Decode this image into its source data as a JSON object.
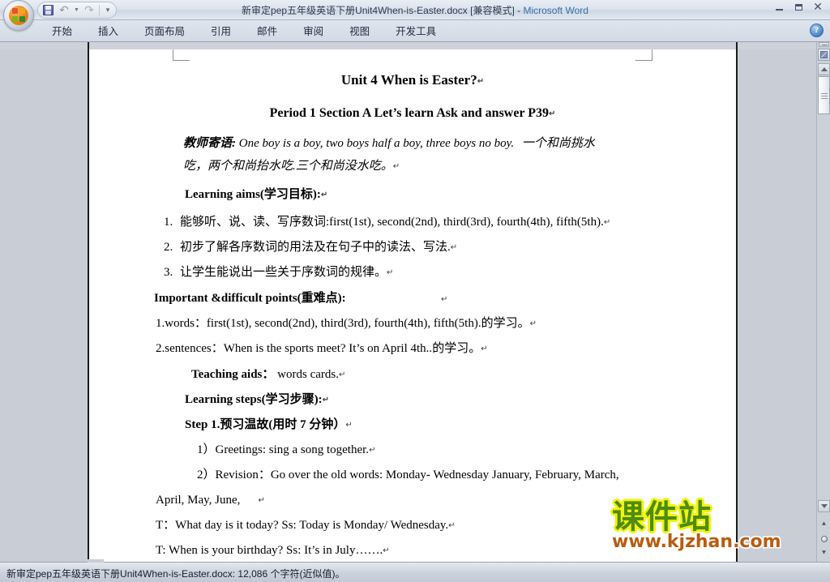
{
  "window": {
    "title_document": "新审定pep五年级英语下册Unit4When-is-Easter.docx [兼容模式]",
    "title_separator": " - ",
    "title_app": "Microsoft Word",
    "minimize_label": "",
    "restore_label": "",
    "close_label": "✕"
  },
  "quick_access": {
    "save_label": "",
    "undo_label": "↰",
    "undo_dropdown": "▾",
    "redo_label": "↻",
    "customize_label": "▾"
  },
  "ribbon": {
    "tabs": [
      {
        "label": "开始"
      },
      {
        "label": "插入"
      },
      {
        "label": "页面布局"
      },
      {
        "label": "引用"
      },
      {
        "label": "邮件"
      },
      {
        "label": "审阅"
      },
      {
        "label": "视图"
      },
      {
        "label": "开发工具"
      }
    ],
    "help_label": "?"
  },
  "document": {
    "lines": [
      {
        "id": "title",
        "text": "Unit 4    When is Easter?",
        "mark": "↵"
      },
      {
        "id": "subtitle",
        "text": "Period 1 Section A    Let’s learn    Ask and answer    P39",
        "mark": "↵"
      },
      {
        "id": "quote_cn",
        "text": "教师寄语:",
        "mark": ""
      },
      {
        "id": "quote_en",
        "text": "One boy is a boy, two boys half a boy, three boys no boy.",
        "mark": ""
      },
      {
        "id": "quote_cn2",
        "text": "一个和尚挑水",
        "mark": ""
      },
      {
        "id": "quote_cn3",
        "text": "吃，两个和尚抬水吃.三个和尚没水吃。",
        "mark": "↵"
      },
      {
        "id": "aims_head",
        "text": "Learning aims(学习目标):",
        "mark": "↵"
      },
      {
        "id": "aim1_num",
        "text": "1.",
        "mark": ""
      },
      {
        "id": "aim1_cn",
        "text": "能够听、说、读、写序数词:",
        "mark": ""
      },
      {
        "id": "aim1_en",
        "text": "first(1st), second(2nd), third(3rd),   fourth(4th), fifth(5th).",
        "mark": "↵"
      },
      {
        "id": "aim2_num",
        "text": "2.",
        "mark": ""
      },
      {
        "id": "aim2",
        "text": "初步了解各序数词的用法及在句子中的读法、写法.",
        "mark": "↵"
      },
      {
        "id": "aim3_num",
        "text": "3.",
        "mark": ""
      },
      {
        "id": "aim3",
        "text": "让学生能说出一些关于序数词的规律。",
        "mark": "↵"
      },
      {
        "id": "points_head",
        "text": "Important &difficult points(重难点):",
        "mark": "↵"
      },
      {
        "id": "words_line_a",
        "text": "1.words：first(1st), second(2nd), third(3rd),   fourth(4th), fifth(5th).",
        "mark": ""
      },
      {
        "id": "words_line_b",
        "text": "的学习。",
        "mark": "↵"
      },
      {
        "id": "sent_line_a",
        "text": "2.sentences：When is the sports meet?   It’s on April 4th..",
        "mark": ""
      },
      {
        "id": "sent_line_b",
        "text": "的学习。",
        "mark": "↵"
      },
      {
        "id": "aids_head",
        "text": "Teaching   aids：",
        "mark": ""
      },
      {
        "id": "aids_body",
        "text": "words cards.",
        "mark": "↵"
      },
      {
        "id": "steps_head",
        "text": "Learning steps(学习步骤):",
        "mark": "↵"
      },
      {
        "id": "step1",
        "text": "Step 1.预习温故(用时 7 分钟）",
        "mark": "↵"
      },
      {
        "id": "g1",
        "text": "1）Greetings: sing a song together.",
        "mark": "↵"
      },
      {
        "id": "g2",
        "text": "2）Revision：Go over the old words: Monday- Wednesday January, February, March,",
        "mark": ""
      },
      {
        "id": "g2b",
        "text": "April,    May,  June,",
        "mark": "↵"
      },
      {
        "id": "t1",
        "text": "T：What day is it today?        Ss: Today is Monday/ Wednesday.",
        "mark": "↵"
      },
      {
        "id": "t2",
        "text": "T:    When is your birthday?       Ss: It’s in July…….",
        "mark": "↵"
      }
    ]
  },
  "watermark": {
    "chinese": "课件站",
    "url": "www.kjzhan.com",
    "color_text": "#4e8c0b",
    "color_outline": "#f2f213",
    "color_url": "#b85c10"
  },
  "statusbar": {
    "text": "新审定pep五年级英语下册Unit4When-is-Easter.docx: 12,086 个字符(近似值)。"
  },
  "scrollbar": {
    "previous_page": "⯅",
    "select_object": "",
    "next_page": "⯆",
    "up_label": "",
    "down_label": ""
  },
  "colors": {
    "workspace_bg": "#c9cdd6",
    "page_bg": "#ffffff",
    "titlebar_accent": "#3b6ea8"
  }
}
